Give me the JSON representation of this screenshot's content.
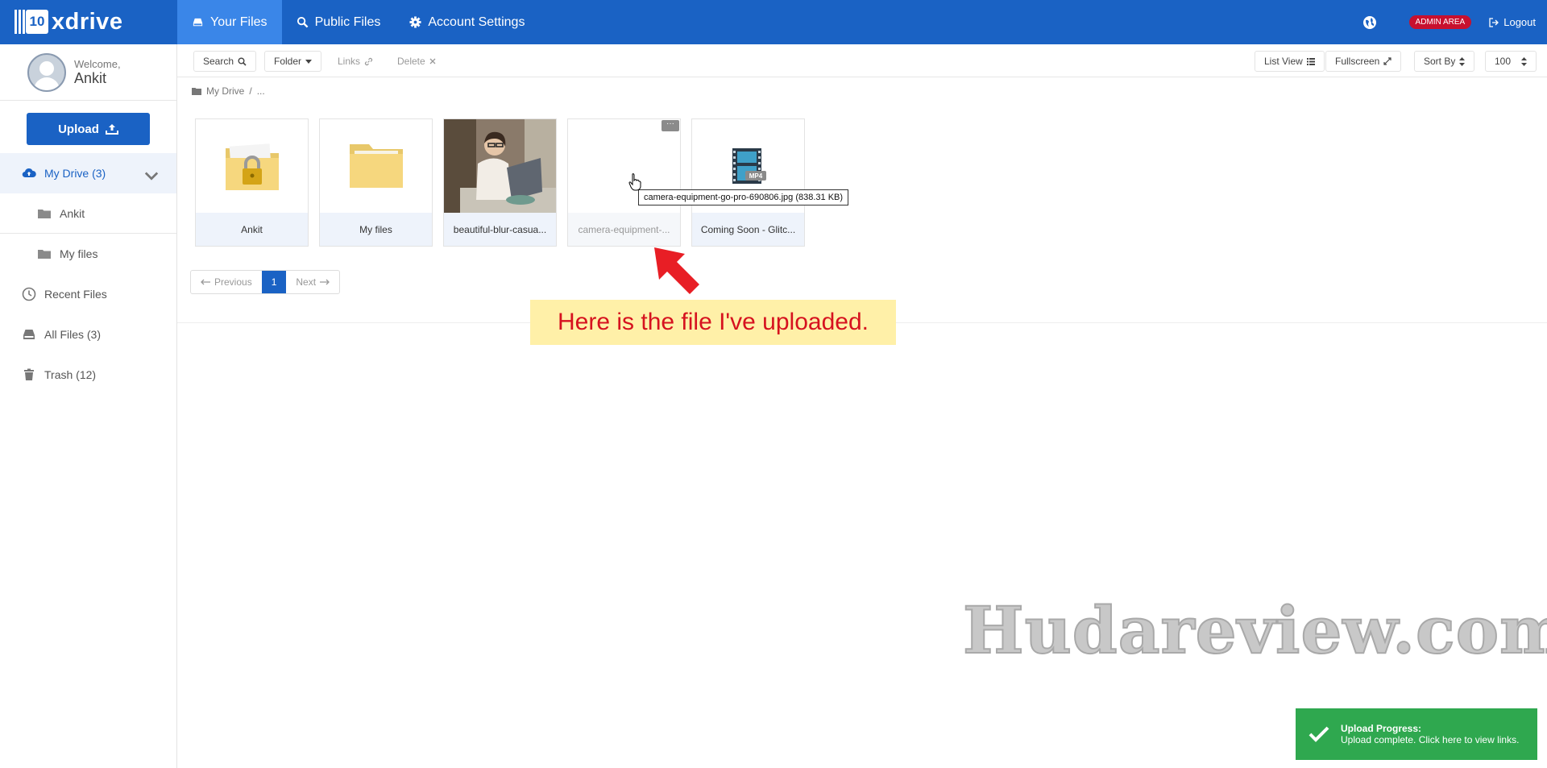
{
  "app": {
    "logo_mark": "10",
    "logo_text": "xdrive"
  },
  "nav": {
    "items": [
      {
        "label": "Your Files",
        "icon": "drive-icon",
        "active": true
      },
      {
        "label": "Public Files",
        "icon": "search-icon",
        "active": false
      },
      {
        "label": "Account Settings",
        "icon": "gear-icon",
        "active": false
      }
    ],
    "admin_label": "ADMIN AREA",
    "logout_label": "Logout"
  },
  "sidebar": {
    "welcome_label": "Welcome,",
    "user_name": "Ankit",
    "upload_label": "Upload",
    "items": [
      {
        "label": "My Drive (3)",
        "icon": "cloud-icon"
      },
      {
        "label": "Ankit",
        "icon": "folder-icon"
      },
      {
        "label": "My files",
        "icon": "folder-icon"
      },
      {
        "label": "Recent Files",
        "icon": "clock-icon"
      },
      {
        "label": "All Files (3)",
        "icon": "drive-icon"
      },
      {
        "label": "Trash (12)",
        "icon": "trash-icon"
      }
    ]
  },
  "toolbar": {
    "search": "Search",
    "folder": "Folder",
    "links": "Links",
    "delete": "Delete",
    "list_view": "List View",
    "fullscreen": "Fullscreen",
    "sort_by": "Sort By",
    "per_page": "100"
  },
  "breadcrumb": {
    "root": "My Drive",
    "sep": "/",
    "more": "..."
  },
  "files": [
    {
      "label": "Ankit",
      "type": "locked-folder"
    },
    {
      "label": "My files",
      "type": "folder"
    },
    {
      "label": "beautiful-blur-casua...",
      "type": "image"
    },
    {
      "label": "camera-equipment-...",
      "type": "uploading-image"
    },
    {
      "label": "Coming Soon - Glitc...",
      "type": "video",
      "badge": "MP4"
    }
  ],
  "tile_menu": "···",
  "tooltip": "camera-equipment-go-pro-690806.jpg (838.31 KB)",
  "pager": {
    "previous": "Previous",
    "current": "1",
    "next": "Next"
  },
  "annotation": "Here is the file I've uploaded.",
  "watermark": "Hudareview.com",
  "toast": {
    "title": "Upload Progress:",
    "message": "Upload complete. Click here to view links."
  },
  "colors": {
    "brand": "#1a62c4",
    "active_nav": "#3a86e8",
    "admin": "#c8102e",
    "success": "#2fa84f",
    "annotation_bg": "#fff0a8",
    "annotation_text": "#d6121f"
  }
}
